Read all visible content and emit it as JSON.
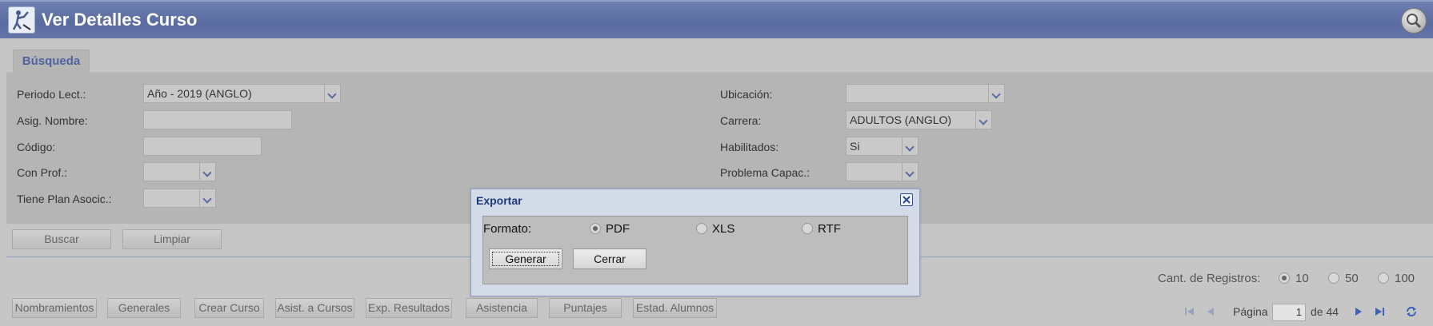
{
  "header": {
    "title": "Ver Detalles Curso",
    "app_icon": "app-logo-icon",
    "search_icon": "magnifier-icon"
  },
  "tabs": [
    {
      "label": "Búsqueda"
    }
  ],
  "form": {
    "periodo": {
      "label": "Periodo Lect.:",
      "value": "Año - 2019 (ANGLO)"
    },
    "asig_nombre": {
      "label": "Asig. Nombre:",
      "value": ""
    },
    "codigo": {
      "label": "Código:",
      "value": ""
    },
    "con_prof": {
      "label": "Con Prof.:",
      "value": ""
    },
    "tiene_plan": {
      "label": "Tiene Plan Asocic.:",
      "value": ""
    },
    "ubicacion": {
      "label": "Ubicación:",
      "value": ""
    },
    "carrera": {
      "label": "Carrera:",
      "value": "ADULTOS (ANGLO)"
    },
    "habilitados": {
      "label": "Habilitados:",
      "value": "Si"
    },
    "problema_capac": {
      "label": "Problema Capac.:",
      "value": ""
    }
  },
  "search_buttons": {
    "buscar": "Buscar",
    "limpiar": "Limpiar"
  },
  "records": {
    "label": "Cant. de Registros:",
    "options": [
      "10",
      "50",
      "100"
    ],
    "selected": "10"
  },
  "toolbar": [
    "Nombramientos",
    "Generales",
    "Crear Curso",
    "Asist. a Cursos",
    "Exp. Resultados",
    "Asistencia",
    "Puntajes",
    "Estad. Alumnos"
  ],
  "pager": {
    "page_label": "Página",
    "page": "1",
    "of_label": "de 44"
  },
  "dialog": {
    "title": "Exportar",
    "format_label": "Formato:",
    "options": [
      "PDF",
      "XLS",
      "RTF"
    ],
    "selected": "PDF",
    "generate": "Generar",
    "close": "Cerrar"
  },
  "colors": {
    "header": "#5a6ba0",
    "accent": "#4f63a0",
    "dialog_title": "#1e3a7a"
  }
}
